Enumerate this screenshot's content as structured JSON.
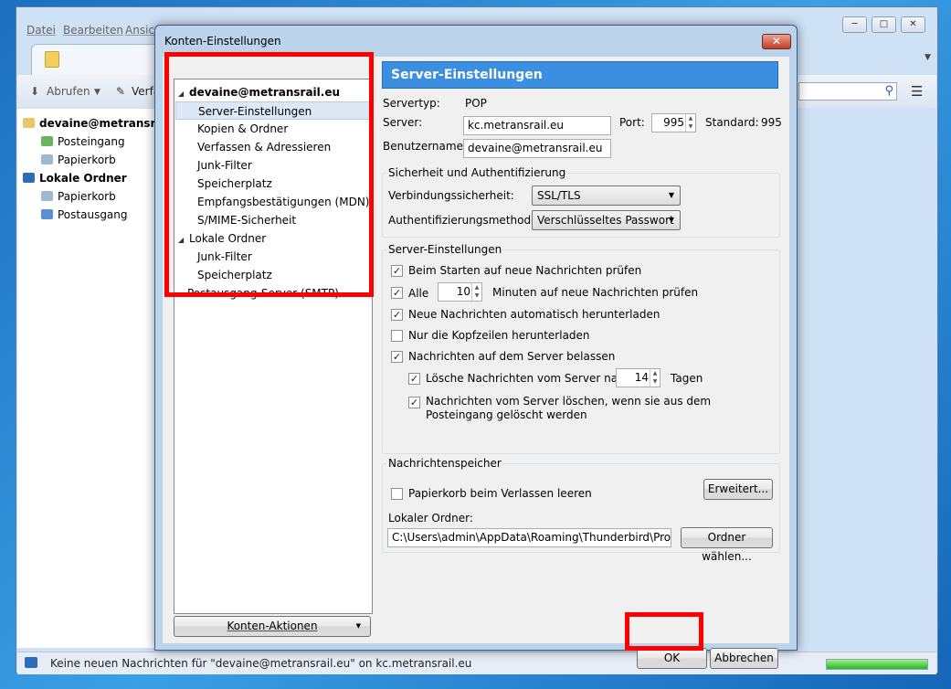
{
  "main_window": {
    "menu": {
      "datei": "Datei",
      "bearbeiten": "Bearbeiten",
      "ansicht": "Ansic"
    },
    "toolbar": {
      "abrufen": "Abrufen",
      "verfassen": "Verfa"
    },
    "folders": {
      "account": "devaine@metransrai",
      "posteingang": "Posteingang",
      "papierkorb": "Papierkorb",
      "lokale_ordner": "Lokale Ordner",
      "papierkorb_lokal": "Papierkorb",
      "postausgang": "Postausgang"
    },
    "status_text": "Keine neuen Nachrichten für \"devaine@metransrail.eu\" on kc.metransrail.eu"
  },
  "dialog": {
    "title": "Konten-Einstellungen",
    "tree": {
      "account": "devaine@metransrail.eu",
      "items": [
        "Server-Einstellungen",
        "Kopien & Ordner",
        "Verfassen & Adressieren",
        "Junk-Filter",
        "Speicherplatz",
        "Empfangsbestätigungen (MDN)",
        "S/MIME-Sicherheit"
      ],
      "local_folders": "Lokale Ordner",
      "local_items": [
        "Junk-Filter",
        "Speicherplatz"
      ],
      "smtp": "Postausgang-Server (SMTP)"
    },
    "account_actions": "Konten-Aktionen",
    "ok": "OK",
    "cancel": "Abbrechen",
    "panel": {
      "header": "Server-Einstellungen",
      "servertype_label": "Servertyp:",
      "servertype_value": "POP",
      "server_label": "Server:",
      "server_value": "kc.metransrail.eu",
      "port_label": "Port:",
      "port_value": "995",
      "standard_label": "Standard:",
      "standard_value": "995",
      "username_label": "Benutzername:",
      "username_value": "devaine@metransrail.eu",
      "security": {
        "title": "Sicherheit und Authentifizierung",
        "conn_label": "Verbindungssicherheit:",
        "conn_value": "SSL/TLS",
        "auth_label": "Authentifizierungsmethode:",
        "auth_value": "Verschlüsseltes Passwort"
      },
      "server_settings": {
        "title": "Server-Einstellungen",
        "check_on_start": "Beim Starten auf neue Nachrichten prüfen",
        "every_label": "Alle",
        "every_value": "10",
        "every_suffix": "Minuten auf neue Nachrichten prüfen",
        "auto_download": "Neue Nachrichten automatisch herunterladen",
        "headers_only": "Nur die Kopfzeilen herunterladen",
        "leave_on_server": "Nachrichten auf dem Server belassen",
        "delete_after_label": "Lösche Nachrichten vom Server nach",
        "delete_after_value": "14",
        "delete_after_suffix": "Tagen",
        "delete_when_removed": "Nachrichten vom Server löschen, wenn sie aus dem Posteingang gelöscht werden"
      },
      "storage": {
        "title": "Nachrichtenspeicher",
        "empty_trash": "Papierkorb beim Verlassen leeren",
        "advanced": "Erweitert...",
        "local_dir_label": "Lokaler Ordner:",
        "local_dir_value": "C:\\Users\\admin\\AppData\\Roaming\\Thunderbird\\Profiles\\",
        "choose_dir": "Ordner wählen..."
      }
    }
  },
  "colors": {
    "highlight": "#ff0000",
    "header": "#3c8ee0"
  }
}
